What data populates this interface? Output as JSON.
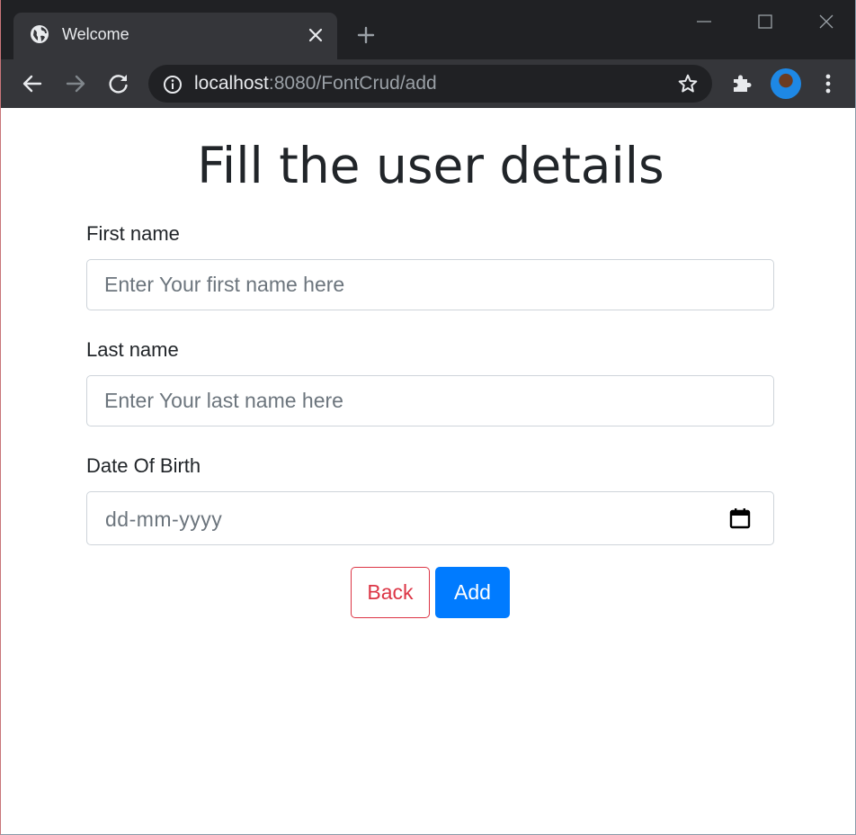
{
  "browser": {
    "tab_title": "Welcome",
    "url_host": "localhost",
    "url_path": ":8080/FontCrud/add",
    "icons": {
      "favicon": "globe-icon",
      "tab_close": "close-icon",
      "new_tab": "plus-icon",
      "minimize": "minimize-icon",
      "maximize": "maximize-icon",
      "close_window": "close-icon",
      "back": "arrow-left-icon",
      "forward": "arrow-right-icon",
      "reload": "reload-icon",
      "site_info": "info-icon",
      "bookmark": "star-icon",
      "extensions": "puzzle-icon",
      "profile": "avatar",
      "menu": "kebab-menu-icon"
    },
    "colors": {
      "tabstrip": "#202124",
      "toolbar": "#35363a",
      "omnibox": "#202124"
    }
  },
  "form": {
    "heading": "Fill the user details",
    "first_name": {
      "label": "First name",
      "placeholder": "Enter Your first name here",
      "value": ""
    },
    "last_name": {
      "label": "Last name",
      "placeholder": "Enter Your last name here",
      "value": ""
    },
    "dob": {
      "label": "Date Of Birth",
      "placeholder": "dd-mm-yyyy",
      "icon": "calendar-icon"
    },
    "buttons": {
      "back": "Back",
      "add": "Add"
    },
    "colors": {
      "back": "#dc3545",
      "add": "#007bff",
      "text": "#212529",
      "placeholder": "#6c757d",
      "border": "#ced4da"
    }
  }
}
